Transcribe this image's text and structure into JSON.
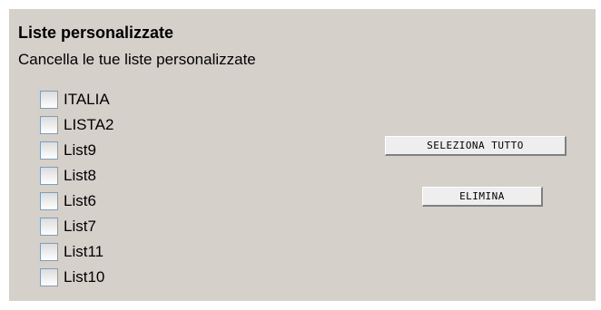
{
  "section": {
    "title": "Liste personalizzate",
    "subtitle": "Cancella le tue liste personalizzate"
  },
  "lists": [
    {
      "label": "ITALIA",
      "checked": false
    },
    {
      "label": "LISTA2",
      "checked": false
    },
    {
      "label": "List9",
      "checked": false
    },
    {
      "label": "List8",
      "checked": false
    },
    {
      "label": "List6",
      "checked": false
    },
    {
      "label": "List7",
      "checked": false
    },
    {
      "label": "List11",
      "checked": false
    },
    {
      "label": "List10",
      "checked": false
    }
  ],
  "actions": {
    "select_all_label": "SELEZIONA TUTTO",
    "delete_label": "ELIMINA"
  },
  "colors": {
    "panel_background": "#d6d0cb",
    "checkbox_border": "#7f9db9"
  }
}
